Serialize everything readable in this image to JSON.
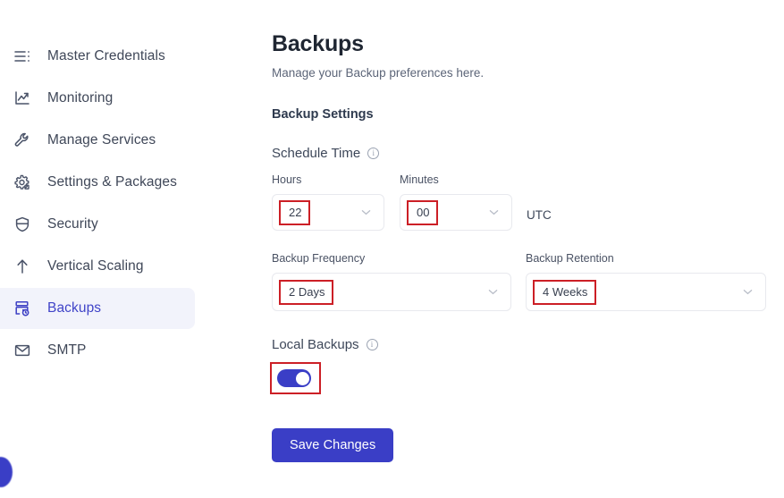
{
  "sidebar": {
    "items": [
      {
        "label": "Master Credentials",
        "icon": "list-menu-icon",
        "active": false
      },
      {
        "label": "Monitoring",
        "icon": "chart-line-icon",
        "active": false
      },
      {
        "label": "Manage Services",
        "icon": "wrench-icon",
        "active": false
      },
      {
        "label": "Settings & Packages",
        "icon": "gear-icon",
        "active": false
      },
      {
        "label": "Security",
        "icon": "shield-icon",
        "active": false
      },
      {
        "label": "Vertical Scaling",
        "icon": "arrow-up-icon",
        "active": false
      },
      {
        "label": "Backups",
        "icon": "backup-database-icon",
        "active": true
      },
      {
        "label": "SMTP",
        "icon": "envelope-icon",
        "active": false
      }
    ]
  },
  "main": {
    "title": "Backups",
    "subtitle": "Manage your Backup preferences here.",
    "section_title": "Backup Settings",
    "schedule": {
      "group_label": "Schedule Time",
      "hours_label": "Hours",
      "hours_value": "22",
      "minutes_label": "Minutes",
      "minutes_value": "00",
      "timezone": "UTC"
    },
    "frequency": {
      "label": "Backup Frequency",
      "value": "2 Days"
    },
    "retention": {
      "label": "Backup Retention",
      "value": "4 Weeks"
    },
    "local_backups": {
      "label": "Local Backups",
      "enabled": "on"
    },
    "save_label": "Save Changes"
  },
  "colors": {
    "accent": "#3a3ec6",
    "active_nav_bg": "#f2f3fb",
    "annotation": "#cc1f26",
    "border": "#e8e9ee",
    "text_primary": "#1f2632",
    "text_secondary": "#5c6578"
  }
}
